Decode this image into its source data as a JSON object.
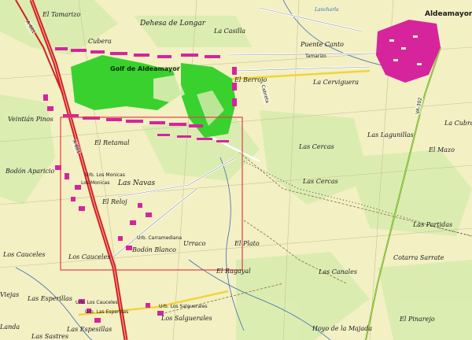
{
  "places": {
    "el_tamarizo": "El Tamarizo",
    "cubera": "Cubera",
    "dehesa_de_longar": "Dehesa de Longar",
    "la_casilla": "La Casilla",
    "lancharla": "Lancharla",
    "aldeamayor": "Aldeamayor",
    "puente_canto": "Puente Canto",
    "tamarizo_small": "Tamarizo",
    "golf": "Golf de Aldeamayor",
    "el_berrojo": "El Berrojo",
    "la_cerviguera": "La Cerviguera",
    "veintian_pinos": "Veintián Pinos",
    "el_retamal": "El Retamal",
    "las_cercas_1": "Las Cercas",
    "las_lagunillas": "Las Lagunillas",
    "la_cubra": "La Cubra",
    "el_mazo": "El Mazo",
    "bodon_aparicio": "Bodón Aparicio",
    "urb_los_monicas": "Urb. Los Monicas",
    "los_monicas": "Los Monicas",
    "las_navas": "Las Navas",
    "las_cercas_2": "Las Cercas",
    "el_reloj": "El Reloj",
    "las_partidas": "Las Partidas",
    "urb_carramediana": "Urb. Carramediana",
    "urraco": "Urraco",
    "bodon_blanco": "Bodón Blanco",
    "el_plato": "El Plato",
    "los_cauceles_1": "Los Cauceles",
    "los_cauceles_2": "Los Cauceles",
    "cotarra_sarrate": "Cotarra Sarrate",
    "el_ragayal": "El Ragayal",
    "las_canales": "Las Canales",
    "viejas": "Viejas",
    "las_esperillas": "Las Esperillas",
    "urb_los_cauceles": "Urb. Los Cauceles",
    "urb_los_salguerales": "Urb. Los Salguerales",
    "urb_las_esperillas": "Urb. Las Esperillas",
    "los_salguerales": "Los Salguerales",
    "el_pinarejo": "El Pinarejo",
    "hoyo_de_la_majada": "Hoyo de la Majada",
    "landa": "Landa",
    "las_espesillas": "Las Espesillas",
    "las_sastres": "Las Sastres"
  },
  "roads": {
    "a601_a": "A-601",
    "a601_b": "A-601",
    "va302": "VA-302",
    "cabreta": "Cabreta"
  },
  "colors": {
    "land": "#f3f0c4",
    "golf_green": "#39d12e",
    "urban_magenta": "#d6249c",
    "motorway": "#d22020",
    "water": "#3d6bb5",
    "frame": "#e04040",
    "green_road": "#3ab03a"
  },
  "frame": {
    "label": "highlighted area"
  }
}
